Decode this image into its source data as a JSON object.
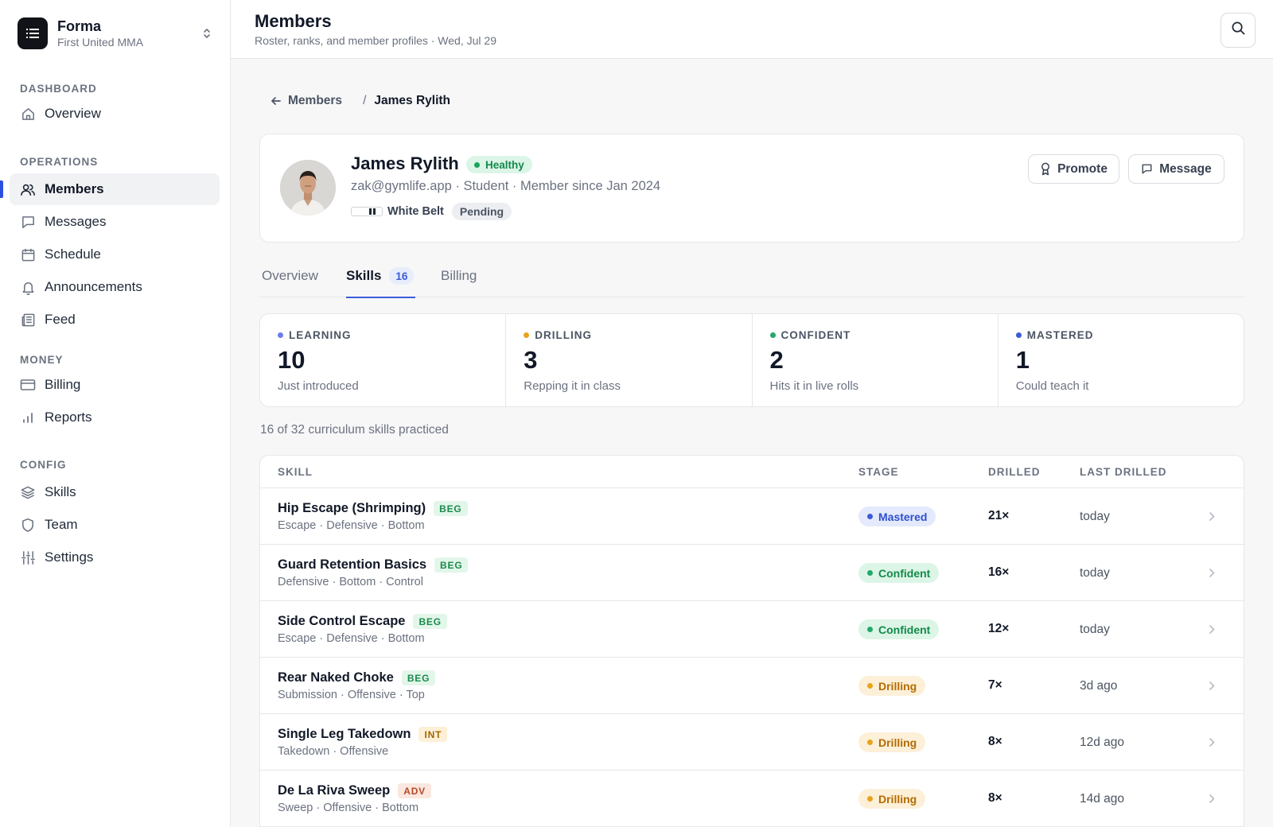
{
  "brand": {
    "name": "Forma",
    "org": "First United MMA"
  },
  "nav": {
    "sections": [
      {
        "heading": "DASHBOARD",
        "items": [
          {
            "label": "Overview",
            "icon": "home-icon"
          }
        ]
      },
      {
        "heading": "OPERATIONS",
        "items": [
          {
            "label": "Members",
            "icon": "users-icon",
            "active": true
          },
          {
            "label": "Messages",
            "icon": "message-icon"
          },
          {
            "label": "Schedule",
            "icon": "calendar-icon"
          },
          {
            "label": "Announcements",
            "icon": "bell-icon"
          },
          {
            "label": "Feed",
            "icon": "newspaper-icon"
          }
        ]
      },
      {
        "heading": "MONEY",
        "items": [
          {
            "label": "Billing",
            "icon": "credit-card-icon"
          },
          {
            "label": "Reports",
            "icon": "bar-chart-icon"
          }
        ]
      },
      {
        "heading": "CONFIG",
        "items": [
          {
            "label": "Skills",
            "icon": "layers-icon"
          },
          {
            "label": "Team",
            "icon": "shield-icon"
          },
          {
            "label": "Settings",
            "icon": "sliders-icon"
          }
        ]
      }
    ]
  },
  "header": {
    "title": "Members",
    "subtitle": "Roster, ranks, and member profiles · Wed, Jul 29"
  },
  "breadcrumb": {
    "back": "Members",
    "separator": "/",
    "current": "James Rylith"
  },
  "profile": {
    "name": "James Rylith",
    "status": "Healthy",
    "meta": "zak@gymlife.app · Student · Member since Jan 2024",
    "belt": "White Belt",
    "belt_status": "Pending",
    "actions": {
      "promote": "Promote",
      "message": "Message"
    }
  },
  "tabs": [
    {
      "label": "Overview"
    },
    {
      "label": "Skills",
      "count": "16",
      "active": true
    },
    {
      "label": "Billing"
    }
  ],
  "stats": [
    {
      "label": "LEARNING",
      "value": "10",
      "desc": "Just introduced",
      "color": "#6b7cf0"
    },
    {
      "label": "DRILLING",
      "value": "3",
      "desc": "Repping it in class",
      "color": "#e8a31c"
    },
    {
      "label": "CONFIDENT",
      "value": "2",
      "desc": "Hits it in live rolls",
      "color": "#22a86b"
    },
    {
      "label": "MASTERED",
      "value": "1",
      "desc": "Could teach it",
      "color": "#3b5bdb"
    }
  ],
  "practiced": "16 of 32 curriculum skills practiced",
  "table": {
    "headers": {
      "skill": "SKILL",
      "stage": "STAGE",
      "drilled": "DRILLED",
      "last": "LAST DRILLED"
    },
    "rows": [
      {
        "name": "Hip Escape (Shrimping)",
        "level": "BEG",
        "tags": "Escape · Defensive · Bottom",
        "stage": "Mastered",
        "drilled": "21×",
        "last": "today"
      },
      {
        "name": "Guard Retention Basics",
        "level": "BEG",
        "tags": "Defensive · Bottom · Control",
        "stage": "Confident",
        "drilled": "16×",
        "last": "today"
      },
      {
        "name": "Side Control Escape",
        "level": "BEG",
        "tags": "Escape · Defensive · Bottom",
        "stage": "Confident",
        "drilled": "12×",
        "last": "today"
      },
      {
        "name": "Rear Naked Choke",
        "level": "BEG",
        "tags": "Submission · Offensive · Top",
        "stage": "Drilling",
        "drilled": "7×",
        "last": "3d ago"
      },
      {
        "name": "Single Leg Takedown",
        "level": "INT",
        "tags": "Takedown · Offensive",
        "stage": "Drilling",
        "drilled": "8×",
        "last": "12d ago"
      },
      {
        "name": "De La Riva Sweep",
        "level": "ADV",
        "tags": "Sweep · Offensive · Bottom",
        "stage": "Drilling",
        "drilled": "8×",
        "last": "14d ago"
      }
    ]
  },
  "colors": {
    "accent": "#3b5bdb",
    "healthy_bg": "#dcf5e7",
    "healthy_fg": "#138a4a",
    "mastered_bg": "#e4eafc",
    "mastered_fg": "#2f4fcf",
    "confident_bg": "#dcf5e7",
    "confident_fg": "#138a4a",
    "drilling_bg": "#fdf0d9",
    "drilling_fg": "#b36b00",
    "beg_bg": "#e3f6ea",
    "beg_fg": "#1b8a4c",
    "int_bg": "#fdf0d6",
    "int_fg": "#a46400",
    "adv_bg": "#fbe7df",
    "adv_fg": "#b34a24"
  }
}
